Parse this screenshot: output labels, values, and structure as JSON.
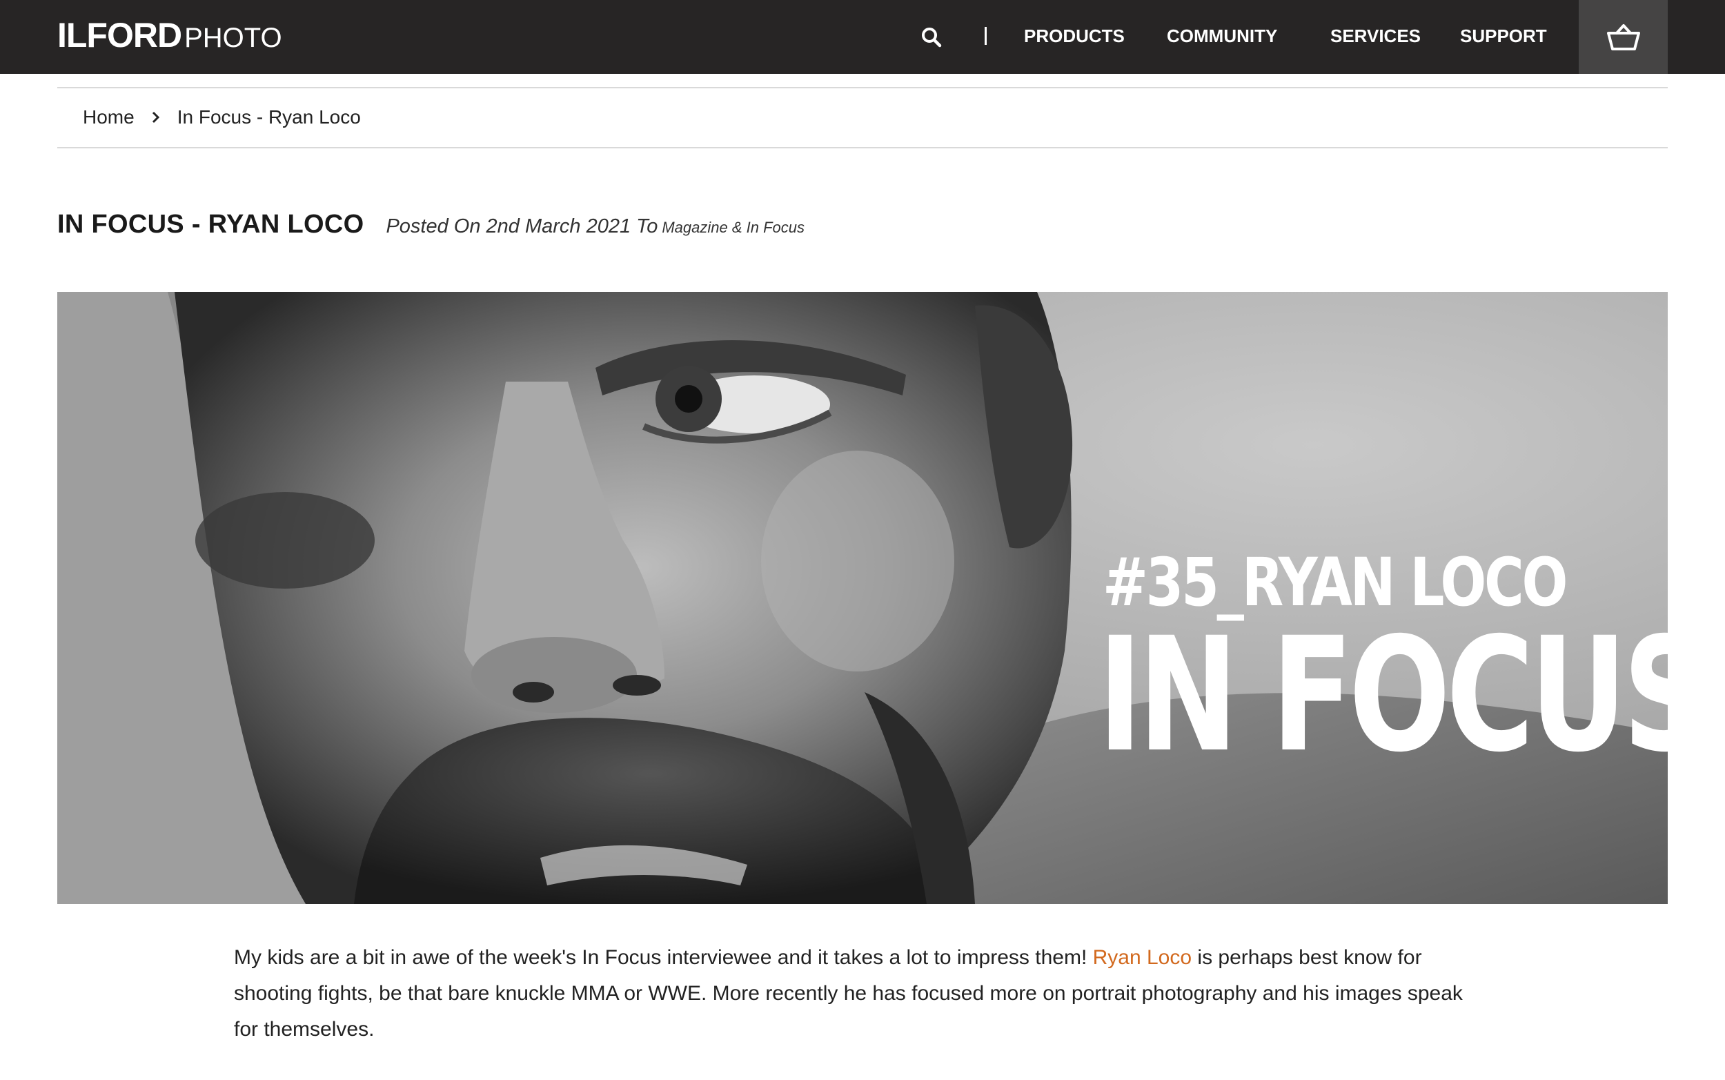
{
  "header": {
    "logo_strong": "ILFORD",
    "logo_light": "PHOTO",
    "nav": [
      "PRODUCTS",
      "COMMUNITY",
      "SERVICES",
      "SUPPORT"
    ],
    "bg_color": "#272525",
    "cart_bg_color": "#454444"
  },
  "breadcrumb": {
    "home": "Home",
    "current": "In Focus - Ryan Loco"
  },
  "article": {
    "title": "IN FOCUS - RYAN LOCO",
    "posted": "Posted On 2nd March 2021 To",
    "categories": "Magazine & In Focus"
  },
  "hero": {
    "subtitle": "#35_RYAN LOCO",
    "headline": "IN FOCUS"
  },
  "body": {
    "intro_before": "My kids are a bit in awe of the week's In Focus interviewee and it takes a lot to impress them! ",
    "link_text": "Ryan Loco",
    "intro_after": " is perhaps best know for shooting fights, be that bare knuckle MMA  or WWE. More recently he has focused more on portrait photography and his images speak for themselves.",
    "link_color": "#d2691e"
  },
  "icons": {
    "search": "search-icon",
    "cart": "basket-icon",
    "breadcrumb_sep": "chevron-right-icon"
  }
}
